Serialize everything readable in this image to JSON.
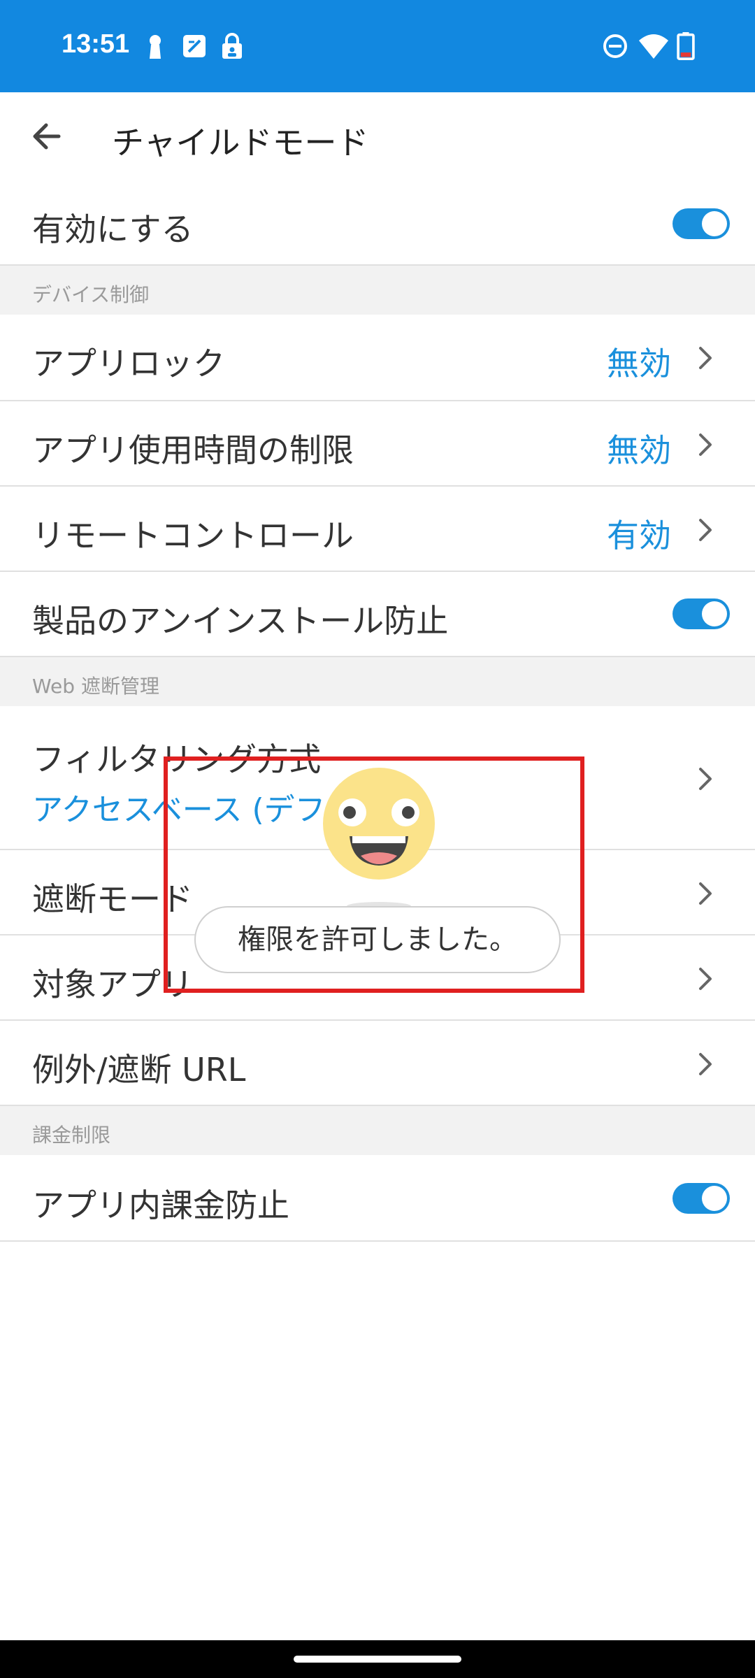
{
  "status_bar": {
    "time": "13:51",
    "icons": [
      "keyhole-icon",
      "sim-icon",
      "lock-icon",
      "dnd-icon",
      "wifi-icon",
      "battery-icon"
    ]
  },
  "app_bar": {
    "title": "チャイルドモード",
    "back_icon": "back-arrow-icon"
  },
  "enable_row": {
    "label": "有効にする",
    "toggle_on": true
  },
  "sections": {
    "device": {
      "header": "デバイス制御",
      "app_lock": {
        "label": "アプリロック",
        "value": "無効"
      },
      "app_time": {
        "label": "アプリ使用時間の制限",
        "value": "無効"
      },
      "remote": {
        "label": "リモートコントロール",
        "value": "有効"
      },
      "uninstall": {
        "label": "製品のアンインストール防止",
        "toggle_on": true
      }
    },
    "web": {
      "header": "Web 遮断管理",
      "filter": {
        "label": "フィルタリング方式",
        "value": "アクセスベース (デフォ"
      },
      "block_mode": {
        "label": "遮断モード"
      },
      "target_apps": {
        "label": "対象アプリ"
      },
      "exception_url": {
        "label": "例外/遮断 URL"
      }
    },
    "billing": {
      "header": "課金制限",
      "iap": {
        "label": "アプリ内課金防止",
        "toggle_on": true
      }
    }
  },
  "toast": {
    "message": "権限を許可しました。",
    "emoji_icon": "smiling-face-icon"
  },
  "colors": {
    "accent": "#1a90dc",
    "status_bar": "#1288e0",
    "highlight": "#e02020"
  }
}
